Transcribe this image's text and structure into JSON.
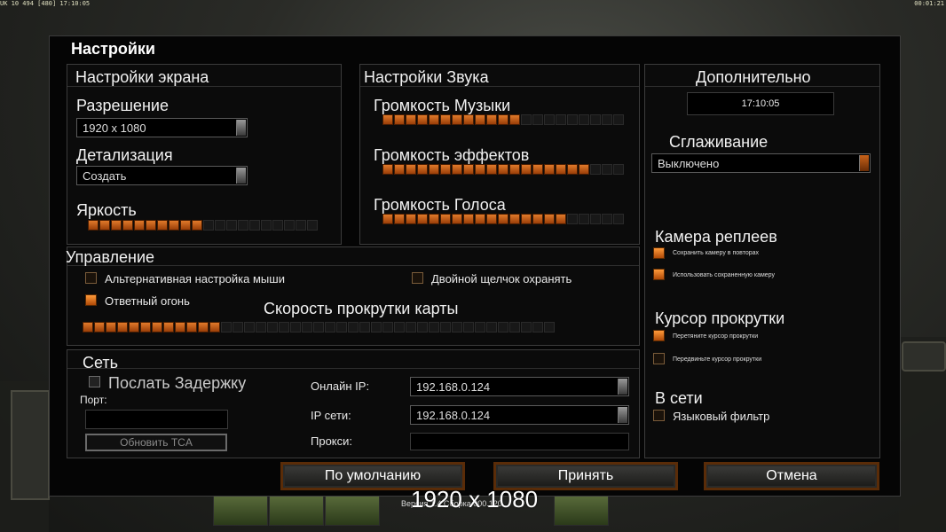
{
  "hud": {
    "left_text": "UK 10 494 [480] 17:10:05",
    "right_text": "00:01:21"
  },
  "dialog": {
    "title": "Настройки"
  },
  "screen": {
    "title": "Настройки экрана",
    "resolution_label": "Разрешение",
    "resolution_value": "1920 x 1080",
    "detail_label": "Детализация",
    "detail_value": "Создать",
    "brightness_label": "Яркость",
    "brightness_level": 10,
    "brightness_max": 20
  },
  "sound": {
    "title": "Настройки Звука",
    "music_label": "Громкость Музыки",
    "music_level": 12,
    "effects_label": "Громкость эффектов",
    "effects_level": 18,
    "voice_label": "Громкость Голоса",
    "voice_level": 16,
    "max": 21
  },
  "extra": {
    "title": "Дополнительно",
    "clock": "17:10:05",
    "antialias_label": "Сглаживание",
    "antialias_value": "Выключено",
    "replay_camera_label": "Камера реплеев",
    "save_camera": "Сохранить камеру в повторах",
    "use_saved_camera": "Использовать сохраненную камеру",
    "scroll_cursor_label": "Курсор прокрутки",
    "drag_cursor": "Перетяните курсор прокрутки",
    "move_cursor": "Передвиньте курсор прокрутки",
    "online_label": "В сети",
    "language_filter": "Языковый фильтр"
  },
  "control": {
    "title": "Управление",
    "alt_mouse": "Альтернативная настройка мыши",
    "double_click": "Двойной щелчок охранять",
    "return_fire": "Ответный огонь",
    "scroll_speed_label": "Скорость прокрутки карты",
    "scroll_level": 12,
    "scroll_max": 41
  },
  "network": {
    "title": "Сеть",
    "send_delay": "Послать Задержку",
    "port_label": "Порт:",
    "update_tca": "Обновить TCA",
    "online_ip_label": "Онлайн IP:",
    "online_ip_value": "192.168.0.124",
    "lan_ip_label": "IP сети:",
    "lan_ip_value": "192.168.0.124",
    "proxy_label": "Прокси:"
  },
  "buttons": {
    "default": "По умолчанию",
    "accept": "Принять",
    "cancel": "Отмена"
  },
  "overlay": {
    "resolution": "1920 x 1080",
    "version": "Версия 1.4 Сборка 000.120"
  },
  "colors": {
    "accent": "#e07a2a",
    "panel_border": "#3c3c3c",
    "background": "#050505"
  }
}
